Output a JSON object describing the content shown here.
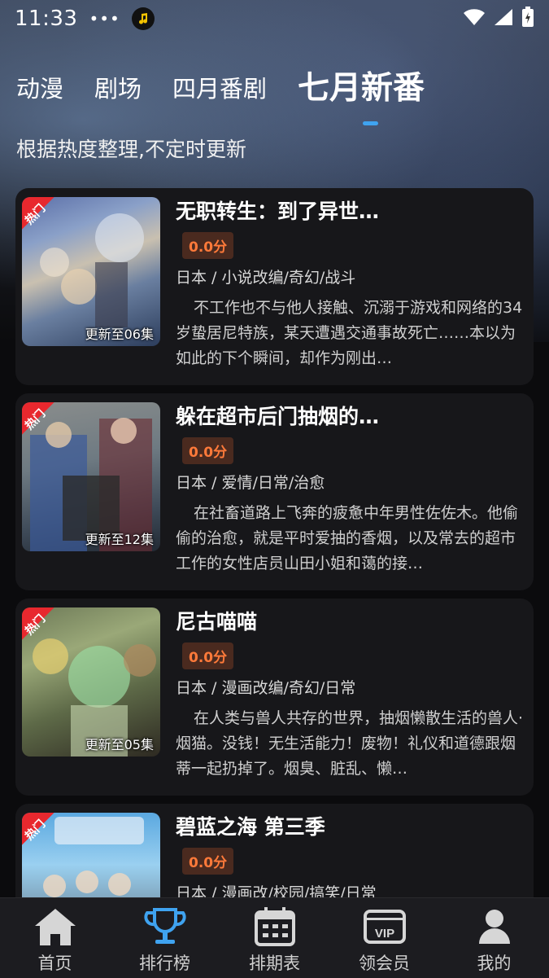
{
  "status": {
    "time": "11:33",
    "dots": "•••"
  },
  "tabs": [
    {
      "label": "动漫"
    },
    {
      "label": "剧场"
    },
    {
      "label": "四月番剧"
    },
    {
      "label": "七月新番"
    }
  ],
  "subtitle": "根据热度整理,不定时更新",
  "hot_label": "热门",
  "accent": "#3fa3f0",
  "cards": [
    {
      "title": "无职转生：到了异世…",
      "score": "0.0分",
      "episodes": "更新至06集",
      "tags": "日本 / 小说改编/奇幻/战斗",
      "description": "不工作也不与他人接触、沉溺于游戏和网络的34岁蛰居尼特族，某天遭遇交通事故死亡……本以为如此的下个瞬间，却作为刚出…"
    },
    {
      "title": "躲在超市后门抽烟的…",
      "score": "0.0分",
      "episodes": "更新至12集",
      "tags": "日本 / 爱情/日常/治愈",
      "description": "在社畜道路上飞奔的疲惫中年男性佐佐木。他偷偷的治愈，就是平时爱抽的香烟，以及常去的超市工作的女性店员山田小姐和蔼的接…"
    },
    {
      "title": "尼古喵喵",
      "score": "0.0分",
      "episodes": "更新至05集",
      "tags": "日本 / 漫画改编/奇幻/日常",
      "description": "在人类与兽人共存的世界，抽烟懒散生活的兽人·烟猫。没钱！无生活能力！废物！礼仪和道德跟烟蒂一起扔掉了。烟臭、脏乱、懒…"
    },
    {
      "title": "碧蓝之海 第三季",
      "score": "0.0分",
      "episodes": "",
      "tags": "日本 / 漫画改/校园/搞笑/日常",
      "description": ""
    }
  ],
  "nav": [
    {
      "label": "首页",
      "icon": "home-icon"
    },
    {
      "label": "排行榜",
      "icon": "trophy-icon"
    },
    {
      "label": "排期表",
      "icon": "calendar-icon"
    },
    {
      "label": "领会员",
      "icon": "vip-icon"
    },
    {
      "label": "我的",
      "icon": "user-icon"
    }
  ]
}
